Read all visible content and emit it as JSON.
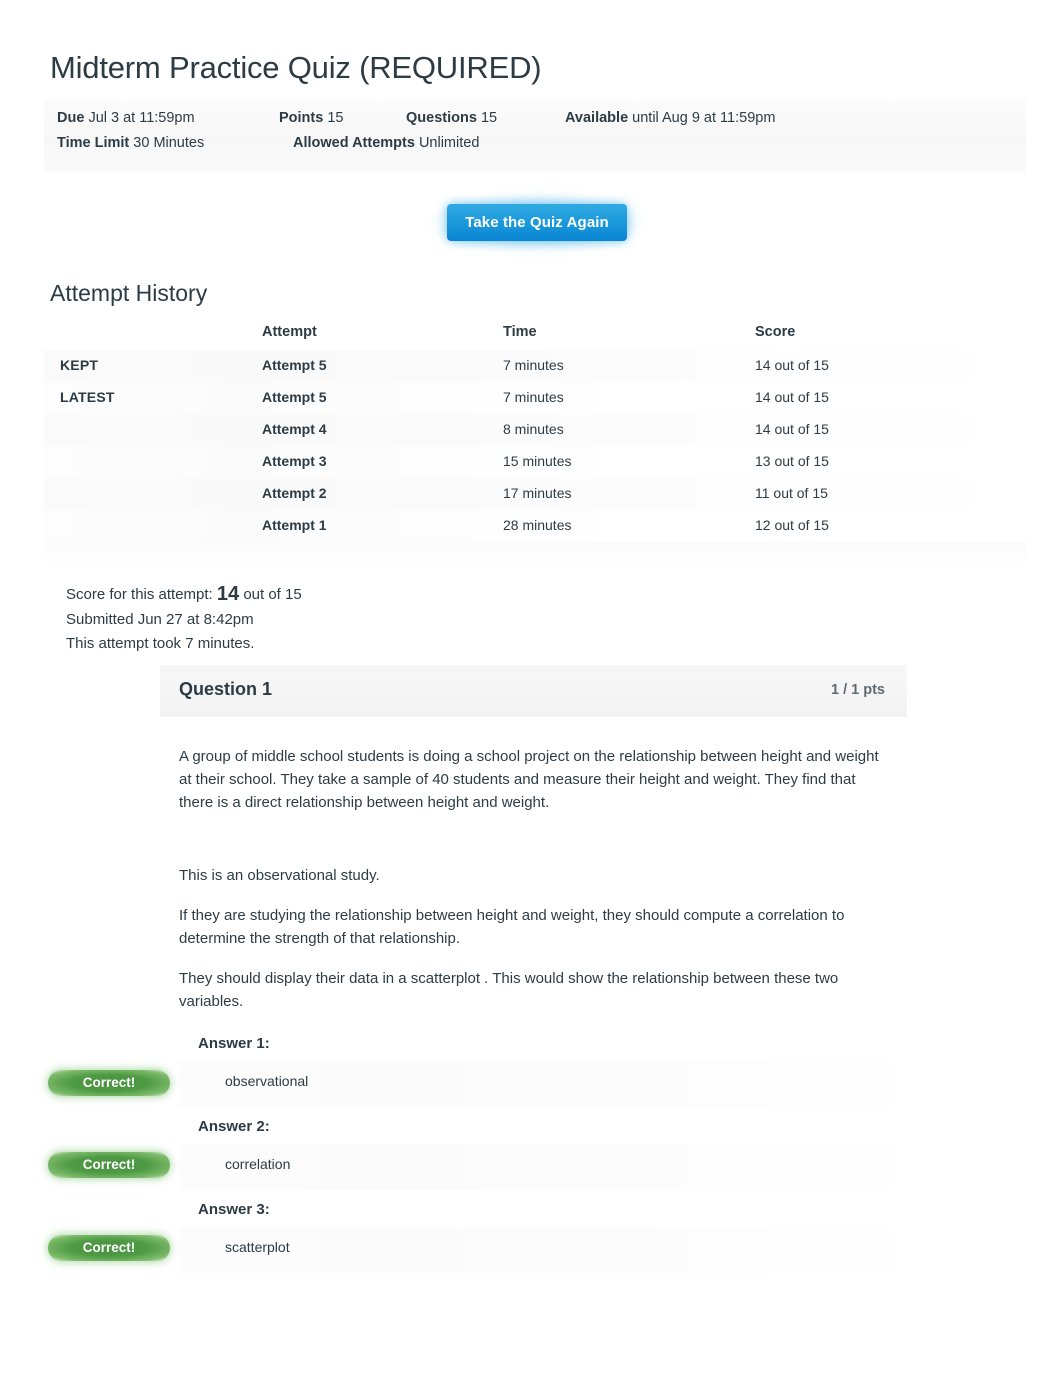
{
  "page": {
    "title": "Midterm Practice Quiz (REQUIRED)"
  },
  "quiz_meta": {
    "due_label": "Due",
    "due_value": "Jul 3 at 11:59pm",
    "points_label": "Points",
    "points_value": "15",
    "questions_label": "Questions",
    "questions_value": "15",
    "available_label": "Available",
    "available_value": "until Aug 9 at 11:59pm",
    "time_limit_label": "Time Limit",
    "time_limit_value": "30 Minutes",
    "allowed_attempts_label": "Allowed Attempts",
    "allowed_attempts_value": "Unlimited"
  },
  "actions": {
    "take_quiz_again": "Take the Quiz Again"
  },
  "attempt_history": {
    "heading": "Attempt History",
    "columns": [
      "",
      "Attempt",
      "Time",
      "Score"
    ],
    "rows": [
      {
        "flag": "KEPT",
        "attempt": "Attempt 5",
        "time": "7 minutes",
        "score": "14 out of 15"
      },
      {
        "flag": "LATEST",
        "attempt": "Attempt 5",
        "time": "7 minutes",
        "score": "14 out of 15"
      },
      {
        "flag": "",
        "attempt": "Attempt 4",
        "time": "8 minutes",
        "score": "14 out of 15"
      },
      {
        "flag": "",
        "attempt": "Attempt 3",
        "time": "15 minutes",
        "score": "13 out of 15"
      },
      {
        "flag": "",
        "attempt": "Attempt 2",
        "time": "17 minutes",
        "score": "11 out of 15"
      },
      {
        "flag": "",
        "attempt": "Attempt 1",
        "time": "28 minutes",
        "score": "12 out of 15"
      }
    ]
  },
  "score_summary": {
    "prefix": "Score for this attempt: ",
    "score": "14",
    "suffix": " out of 15",
    "submitted": "Submitted Jun 27 at 8:42pm",
    "duration": "This attempt took 7 minutes."
  },
  "question": {
    "title": "Question 1",
    "points": "1 / 1 pts",
    "paragraphs": [
      "A group of middle school students is doing a school project on the relationship between height and weight at their school. They take a sample of 40 students and measure their height and weight. They find that there is a direct relationship between height and weight.",
      "This is an observational study.",
      "If they are studying the relationship between height and weight, they should compute a correlation to determine the strength of that relationship.",
      "They should display their data in a scatterplot . This would show the relationship between these two variables."
    ],
    "answers": [
      {
        "label": "Answer 1:",
        "value": "observational",
        "status": "Correct!"
      },
      {
        "label": "Answer 2:",
        "value": "correlation",
        "status": "Correct!"
      },
      {
        "label": "Answer 3:",
        "value": "scatterplot",
        "status": "Correct!"
      }
    ]
  },
  "colors": {
    "link": "#1b9adc",
    "button": "#0a84d2",
    "correct": "#4f9a45",
    "text": "#2d3b45"
  }
}
